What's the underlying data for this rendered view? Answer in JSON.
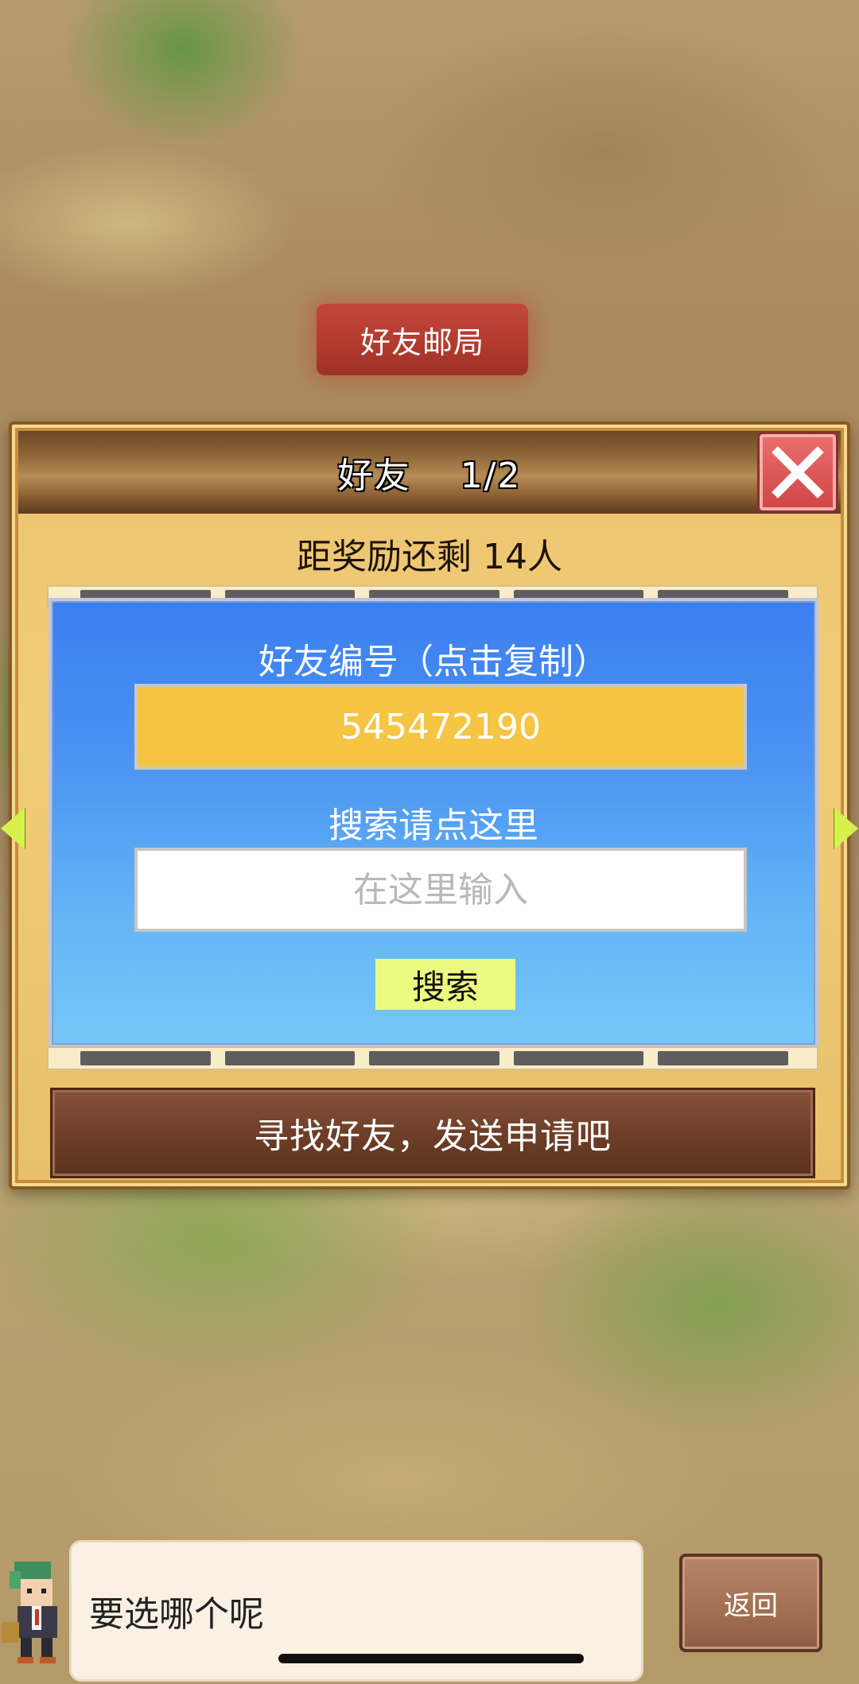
{
  "sign": {
    "label": "好友邮局"
  },
  "panel": {
    "title": "好友　 1/2",
    "close_icon": "close-x-icon",
    "reward_text": "距奖励还剩 14人",
    "friend_box": {
      "code_label": "好友编号（点击复制）",
      "code_value": "545472190",
      "search_label": "搜索请点这里",
      "search_placeholder": "在这里输入",
      "search_button": "搜索"
    },
    "find_button": "寻找好友，发送申请吧"
  },
  "bottom": {
    "speech_text": "要选哪个呢",
    "back_button": "返回"
  },
  "colors": {
    "panel_bg": "#f1cc78",
    "header": "#8d6437",
    "close_red": "#d24646",
    "dialog_blue": "#4a93f2",
    "code_yellow": "#f5c543",
    "search_btn": "#eef97f",
    "find_btn": "#6e3f28"
  }
}
